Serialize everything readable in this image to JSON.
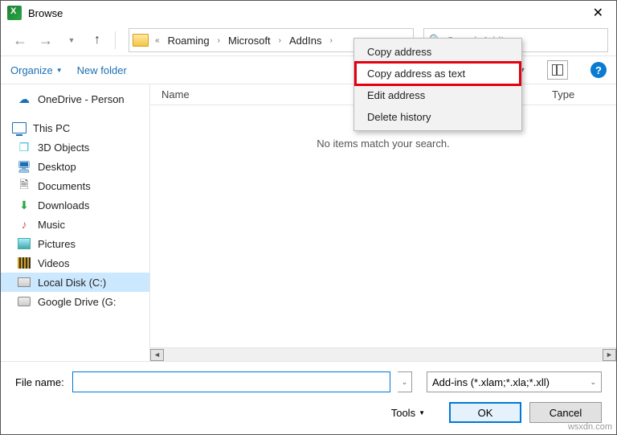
{
  "window": {
    "title": "Browse"
  },
  "nav": {
    "crumbs": {
      "c1": "Roaming",
      "c2": "Microsoft",
      "c3": "AddIns"
    },
    "search_placeholder": "Search AddIns"
  },
  "toolbar": {
    "organize": "Organize",
    "newfolder": "New folder"
  },
  "context_menu": {
    "copy_address": "Copy address",
    "copy_address_text": "Copy address as text",
    "edit_address": "Edit address",
    "delete_history": "Delete history"
  },
  "columns": {
    "name": "Name",
    "type": "Type"
  },
  "content": {
    "empty": "No items match your search."
  },
  "sidebar": {
    "onedrive": "OneDrive - Person",
    "thispc": "This PC",
    "objects3d": "3D Objects",
    "desktop": "Desktop",
    "documents": "Documents",
    "downloads": "Downloads",
    "music": "Music",
    "pictures": "Pictures",
    "videos": "Videos",
    "localdisk": "Local Disk (C:)",
    "googledrive": "Google Drive (G:"
  },
  "bottom": {
    "filename_label": "File name:",
    "filename_value": "",
    "filetype": "Add-ins (*.xlam;*.xla;*.xll)",
    "tools": "Tools",
    "ok": "OK",
    "cancel": "Cancel"
  },
  "watermark": "wsxdn.com"
}
